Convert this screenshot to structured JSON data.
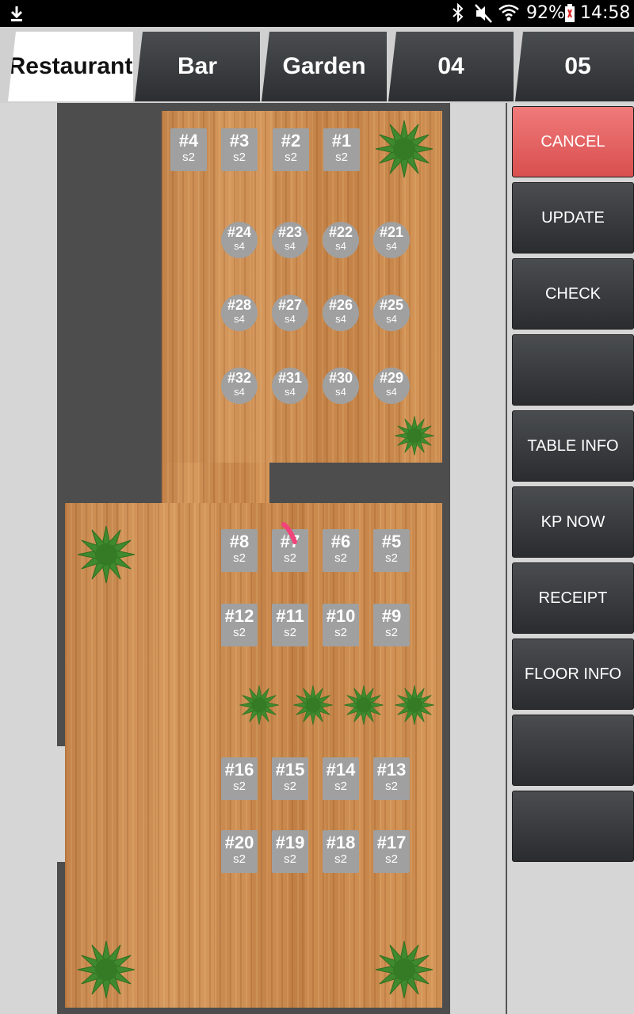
{
  "status": {
    "battery": "92%",
    "time": "14:58",
    "icons": [
      "download-icon",
      "bluetooth-icon",
      "mute-icon",
      "wifi-icon",
      "battery-icon"
    ]
  },
  "tabs": [
    {
      "label": "Restaurant",
      "active": true
    },
    {
      "label": "Bar",
      "active": false
    },
    {
      "label": "Garden",
      "active": false
    },
    {
      "label": "04",
      "active": false
    },
    {
      "label": "05",
      "active": false
    }
  ],
  "tables": [
    {
      "num": "#4",
      "seats": "s2",
      "shape": "square"
    },
    {
      "num": "#3",
      "seats": "s2",
      "shape": "square"
    },
    {
      "num": "#2",
      "seats": "s2",
      "shape": "square"
    },
    {
      "num": "#1",
      "seats": "s2",
      "shape": "square"
    },
    {
      "num": "#24",
      "seats": "s4",
      "shape": "round"
    },
    {
      "num": "#23",
      "seats": "s4",
      "shape": "round"
    },
    {
      "num": "#22",
      "seats": "s4",
      "shape": "round"
    },
    {
      "num": "#21",
      "seats": "s4",
      "shape": "round"
    },
    {
      "num": "#28",
      "seats": "s4",
      "shape": "round"
    },
    {
      "num": "#27",
      "seats": "s4",
      "shape": "round"
    },
    {
      "num": "#26",
      "seats": "s4",
      "shape": "round"
    },
    {
      "num": "#25",
      "seats": "s4",
      "shape": "round"
    },
    {
      "num": "#32",
      "seats": "s4",
      "shape": "round"
    },
    {
      "num": "#31",
      "seats": "s4",
      "shape": "round"
    },
    {
      "num": "#30",
      "seats": "s4",
      "shape": "round"
    },
    {
      "num": "#29",
      "seats": "s4",
      "shape": "round"
    },
    {
      "num": "#8",
      "seats": "s2",
      "shape": "square"
    },
    {
      "num": "#7",
      "seats": "s2",
      "shape": "square"
    },
    {
      "num": "#6",
      "seats": "s2",
      "shape": "square"
    },
    {
      "num": "#5",
      "seats": "s2",
      "shape": "square"
    },
    {
      "num": "#12",
      "seats": "s2",
      "shape": "square"
    },
    {
      "num": "#11",
      "seats": "s2",
      "shape": "square"
    },
    {
      "num": "#10",
      "seats": "s2",
      "shape": "square"
    },
    {
      "num": "#9",
      "seats": "s2",
      "shape": "square"
    },
    {
      "num": "#16",
      "seats": "s2",
      "shape": "square"
    },
    {
      "num": "#15",
      "seats": "s2",
      "shape": "square"
    },
    {
      "num": "#14",
      "seats": "s2",
      "shape": "square"
    },
    {
      "num": "#13",
      "seats": "s2",
      "shape": "square"
    },
    {
      "num": "#20",
      "seats": "s2",
      "shape": "square"
    },
    {
      "num": "#19",
      "seats": "s2",
      "shape": "square"
    },
    {
      "num": "#18",
      "seats": "s2",
      "shape": "square"
    },
    {
      "num": "#17",
      "seats": "s2",
      "shape": "square"
    }
  ],
  "buttons": [
    {
      "label": "CANCEL"
    },
    {
      "label": "UPDATE"
    },
    {
      "label": "CHECK"
    },
    {
      "label": ""
    },
    {
      "label": "TABLE INFO"
    },
    {
      "label": "KP NOW"
    },
    {
      "label": "RECEIPT"
    },
    {
      "label": "FLOOR INFO"
    },
    {
      "label": ""
    },
    {
      "label": ""
    }
  ],
  "colors": {
    "cancel": "#e86060",
    "button_dark": "#3a3c3f",
    "table_gray": "#a0a0a0",
    "wood": "#d08f55",
    "wall": "#4d4d4d",
    "plant": "#3f8a2e"
  }
}
